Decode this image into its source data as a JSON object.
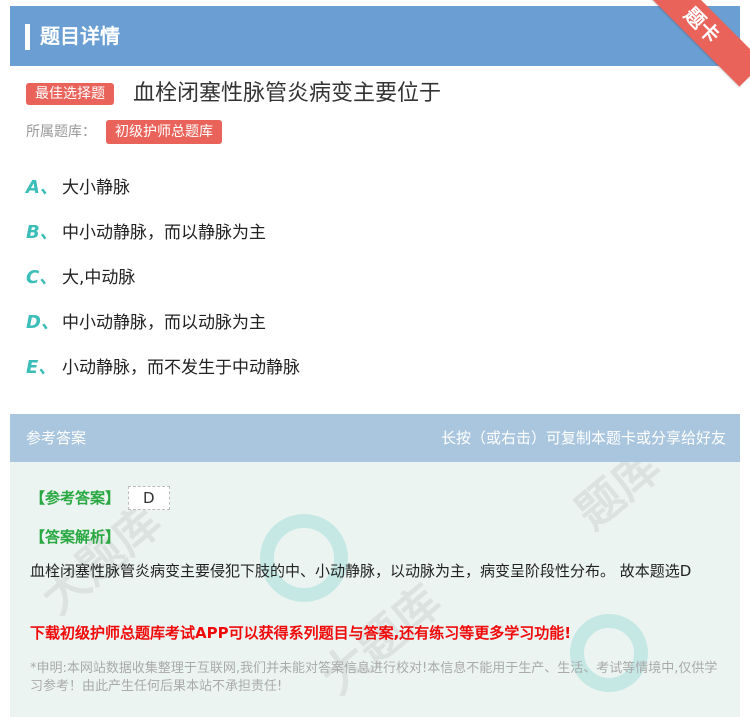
{
  "header": {
    "title": "题目详情",
    "ribbon": "题卡"
  },
  "question": {
    "type_badge": "最佳选择题",
    "text": "血栓闭塞性脉管炎病变主要位于",
    "bank_label": "所属题库：",
    "bank_name": "初级护师总题库"
  },
  "options": [
    {
      "letter": "A、",
      "text": "大小静脉"
    },
    {
      "letter": "B、",
      "text": "中小动静脉，而以静脉为主"
    },
    {
      "letter": "C、",
      "text": "大,中动脉"
    },
    {
      "letter": "D、",
      "text": "中小动静脉，而以动脉为主"
    },
    {
      "letter": "E、",
      "text": "小动静脉，而不发生于中动静脉"
    }
  ],
  "answer_section": {
    "heading": "参考答案",
    "hint": "长按（或右击）可复制本题卡或分享给好友",
    "answer_label": "【参考答案】",
    "answer_value": "D",
    "explanation_label": "【答案解析】",
    "explanation": "血栓闭塞性脉管炎病变主要侵犯下肢的中、小动静脉，以动脉为主，病变呈阶段性分布。 故本题选D",
    "promo": "下载初级护师总题库考试APP可以获得系列题目与答案,还有练习等更多学习功能!",
    "disclaimer": "*申明:本网站数据收集整理于互联网,我们并未能对答案信息进行校对!本信息不能用于生产、生活、考试等情境中,仅供学习参考！由此产生任何后果本站不承担责任!"
  },
  "colors": {
    "header_bg": "#6b9fd3",
    "badge_red": "#e9635b",
    "option_letter": "#3bbdb8",
    "answer_head_bg": "#a9c6de",
    "answer_body_bg": "#ecf4f2",
    "green_label": "#2aa842",
    "promo_red": "#f00b0b"
  }
}
